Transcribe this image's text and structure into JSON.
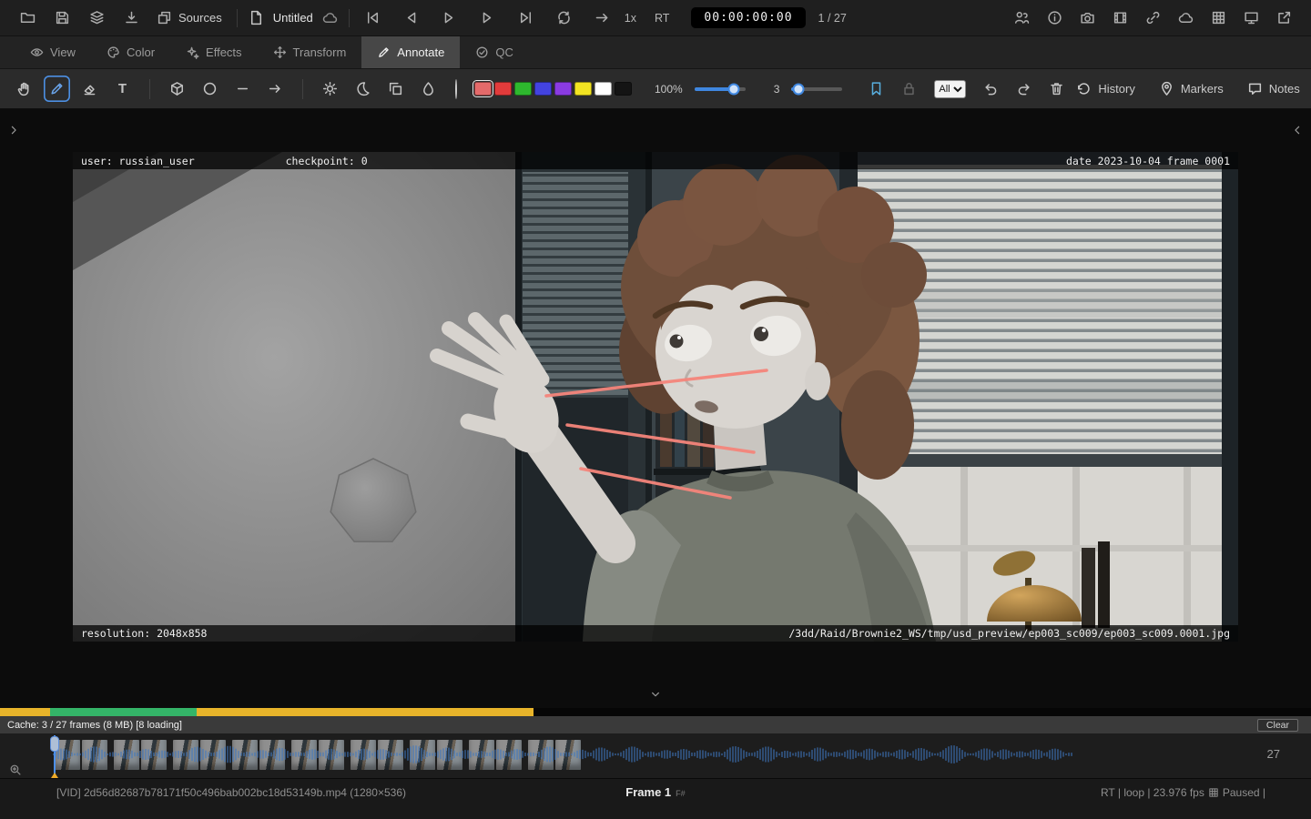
{
  "topbar": {
    "sources": "Sources",
    "doc_title": "Untitled",
    "speed": "1x",
    "rt": "RT",
    "timecode": "00:00:00:00",
    "frame_counter": "1 / 27"
  },
  "tabs": {
    "items": [
      {
        "label": "View"
      },
      {
        "label": "Color"
      },
      {
        "label": "Effects"
      },
      {
        "label": "Transform"
      },
      {
        "label": "Annotate",
        "active": true
      },
      {
        "label": "QC"
      }
    ]
  },
  "annotate_toolbar": {
    "text_tool_glyph": "T",
    "opacity_label": "100%",
    "opacity_pct": 78,
    "size_label": "3",
    "size_pct": 13,
    "scope_selected": "All",
    "history": "History",
    "markers": "Markers",
    "notes": "Notes",
    "palette": [
      "#e46a6a",
      "#e23b3b",
      "#2eb82e",
      "#4343e0",
      "#8a3be2",
      "#f2e422",
      "#ffffff",
      "#141414"
    ],
    "selected_color_index": 0
  },
  "viewer": {
    "burnin": {
      "user": "user: russian_user",
      "checkpoint": "checkpoint: 0",
      "date_frame": "date 2023-10-04 frame 0001",
      "resolution": "resolution: 2048x858",
      "path": "/3dd/Raid/Brownie2_WS/tmp/usd_preview/ep003_sc009/ep003_sc009.0001.jpg"
    }
  },
  "cache": {
    "status": "Cache: 3 / 27 frames (8 MB) [8 loading]",
    "clear": "Clear",
    "segments": [
      {
        "color": "#e8b42a",
        "pct": 3.8
      },
      {
        "color": "#34b468",
        "pct": 11.2
      },
      {
        "color": "#e8b42a",
        "pct": 25.7
      }
    ]
  },
  "timeline": {
    "end_frame": "27",
    "thumb_count": 18
  },
  "statusbar": {
    "media": "[VID] 2d56d82687b78171f50c496bab002bc18d53149b.mp4 (1280×536)",
    "frame": "Frame 1",
    "frame_unit": "F#",
    "rt_loop_fps": "RT | loop | 23.976 fps",
    "paused": "Paused |"
  }
}
